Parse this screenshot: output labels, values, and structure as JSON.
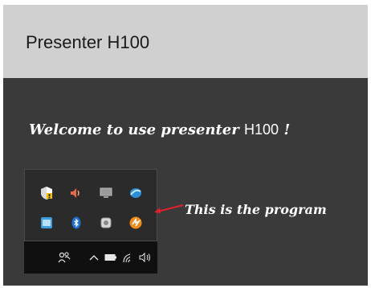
{
  "window": {
    "title": "Presenter H100"
  },
  "content": {
    "welcome_prefix": "Welcome to use  presenter ",
    "welcome_model": "H100",
    "welcome_suffix": " !",
    "annotation": "This is the program"
  },
  "tray": {
    "icons": [
      {
        "name": "security-shield-icon"
      },
      {
        "name": "volume-icon"
      },
      {
        "name": "display-icon"
      },
      {
        "name": "network-app-icon"
      },
      {
        "name": "app-window-icon"
      },
      {
        "name": "bluetooth-icon"
      },
      {
        "name": "storage-icon"
      },
      {
        "name": "presenter-program-icon"
      }
    ]
  },
  "taskbar": {
    "icons": [
      "people-icon",
      "chevron-up-icon",
      "battery-icon",
      "wifi-icon",
      "speaker-icon"
    ]
  },
  "colors": {
    "titlebar": "#d0d0d0",
    "content_bg": "#3a3a3a",
    "arrow": "#e0202a"
  }
}
